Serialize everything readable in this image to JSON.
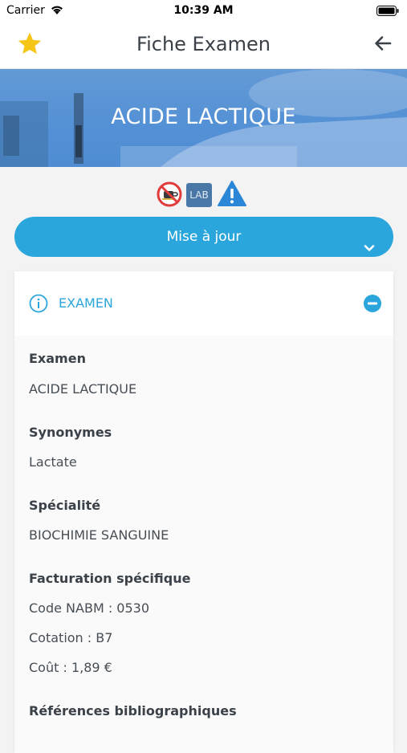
{
  "status": {
    "carrier": "Carrier",
    "time": "10:39 AM"
  },
  "nav": {
    "title": "Fiche Examen"
  },
  "hero": {
    "title": "ACIDE LACTIQUE"
  },
  "badges": {
    "lab": "LAB"
  },
  "update": {
    "label": "Mise à jour"
  },
  "section": {
    "header": "EXAMEN",
    "examen_label": "Examen",
    "examen_value": "ACIDE LACTIQUE",
    "synonymes_label": "Synonymes",
    "synonymes_value": "Lactate",
    "specialite_label": "Spécialité",
    "specialite_value": "BIOCHIMIE SANGUINE",
    "facturation_label": "Facturation spécifique",
    "code_nabm": "Code NABM : 0530",
    "cotation": "Cotation : B7",
    "cout": "Coût : 1,89 €",
    "references_label": "Références bibliographiques"
  },
  "colors": {
    "accent": "#2ba6dc",
    "star": "#f5c518",
    "warn": "#2b86d8"
  },
  "icons": [
    "wifi-icon",
    "battery-icon",
    "star-icon",
    "back-arrow-icon",
    "no-food-icon",
    "warning-icon",
    "chevron-down-icon",
    "info-icon",
    "minus-circle-icon"
  ]
}
